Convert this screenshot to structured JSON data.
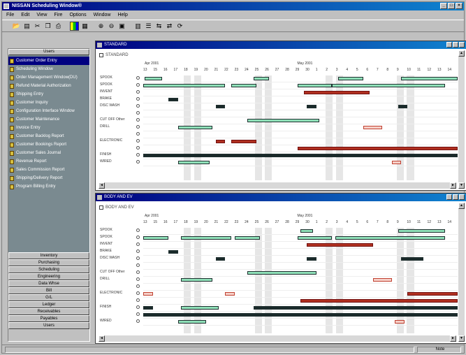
{
  "window": {
    "title": "NISSAN Scheduling Window®"
  },
  "menu": [
    "File",
    "Edit",
    "View",
    "Fire",
    "Options",
    "Window",
    "Help"
  ],
  "toolbar": [
    "open-icon",
    "save-icon",
    "cut-icon",
    "copy-icon",
    "print-icon",
    "color-icon",
    "tool-icon",
    "zoom-in-icon",
    "zoom-out-icon",
    "print-preview-icon",
    "grid-icon",
    "list-icon",
    "arrows-icon",
    "arrows-icon",
    "refresh-icon"
  ],
  "left_panel": {
    "header": "Users",
    "items": [
      "Customer Order Entry",
      "Scheduling Window",
      "Order Management Window(DU)",
      "Refund Material Authorization",
      "Shipping Entry",
      "Customer Inquiry",
      "Configuration Interface Window",
      "Customer Maintenance",
      "Invoice Entry",
      "Customer Backlog Report",
      "Customer Bookings Report",
      "Customer Sales Journal",
      "Revenue Report",
      "Sales Commission Report",
      "Shipping/Delivery Report",
      "Program Billing Entry"
    ],
    "buttons": [
      "Inventory",
      "Purchasing",
      "Scheduling",
      "Engineering",
      "Data Whse",
      "Bill",
      "G/L",
      "Ledger",
      "Receivables",
      "Payables",
      "Users"
    ]
  },
  "windows": [
    {
      "title": "STANDARD",
      "checkbox_label": "STANDARD",
      "months": [
        "Apr 2001",
        "May 2001"
      ],
      "days": [
        "13",
        "15",
        "16",
        "17",
        "18",
        "19",
        "20",
        "21",
        "22",
        "23",
        "24",
        "25",
        "26",
        "27",
        "28",
        "29",
        "30",
        "1",
        "2",
        "3",
        "4",
        "5",
        "6",
        "7",
        "8",
        "9",
        "10",
        "11",
        "12",
        "13",
        "14"
      ],
      "rows": [
        "SPOOK",
        "SPOOK",
        "INVENT",
        "BRAKE",
        "DISC WASH",
        "",
        "CUT OFF Other",
        "DRILL",
        "",
        "ELECTRONIC",
        "",
        "FINISH",
        "WIRED"
      ],
      "bars": [
        {
          "row": 0,
          "start": 0.5,
          "end": 6,
          "type": "g"
        },
        {
          "row": 0,
          "start": 35,
          "end": 40,
          "type": "g"
        },
        {
          "row": 0,
          "start": 62,
          "end": 70,
          "type": "g"
        },
        {
          "row": 0,
          "start": 82,
          "end": 100,
          "type": "g"
        },
        {
          "row": 1,
          "start": 0,
          "end": 26,
          "type": "g"
        },
        {
          "row": 1,
          "start": 28,
          "end": 36,
          "type": "g"
        },
        {
          "row": 1,
          "start": 49,
          "end": 60,
          "type": "g"
        },
        {
          "row": 1,
          "start": 60,
          "end": 96,
          "type": "g"
        },
        {
          "row": 2,
          "start": 51,
          "end": 72,
          "type": "r"
        },
        {
          "row": 3,
          "start": 8,
          "end": 11,
          "type": "d"
        },
        {
          "row": 4,
          "start": 23,
          "end": 26,
          "type": "d"
        },
        {
          "row": 4,
          "start": 52,
          "end": 55,
          "type": "d"
        },
        {
          "row": 4,
          "start": 81,
          "end": 84,
          "type": "d"
        },
        {
          "row": 6,
          "start": 33,
          "end": 56,
          "type": "g"
        },
        {
          "row": 7,
          "start": 11,
          "end": 22,
          "type": "g"
        },
        {
          "row": 7,
          "start": 70,
          "end": 76,
          "type": "w"
        },
        {
          "row": 9,
          "start": 23,
          "end": 26,
          "type": "r"
        },
        {
          "row": 9,
          "start": 28,
          "end": 36,
          "type": "r"
        },
        {
          "row": 10,
          "start": 49,
          "end": 100,
          "type": "r"
        },
        {
          "row": 11,
          "start": 0,
          "end": 100,
          "type": "d"
        },
        {
          "row": 12,
          "start": 11,
          "end": 21,
          "type": "g"
        },
        {
          "row": 12,
          "start": 79,
          "end": 82,
          "type": "w"
        }
      ]
    },
    {
      "title": "BODY AND EV",
      "checkbox_label": "BODY AND EV",
      "months": [
        "Apr 2001",
        "May 2001"
      ],
      "days": [
        "13",
        "15",
        "16",
        "17",
        "18",
        "19",
        "20",
        "21",
        "22",
        "23",
        "24",
        "25",
        "26",
        "27",
        "28",
        "29",
        "30",
        "1",
        "2",
        "3",
        "4",
        "5",
        "6",
        "7",
        "8",
        "9",
        "10",
        "11",
        "12",
        "13",
        "14"
      ],
      "rows": [
        "SPOOK",
        "SPOOK",
        "INVENT",
        "BRAKE",
        "DISC WASH",
        "",
        "CUT OFF Other",
        "DRILL",
        "",
        "ELECTRONIC",
        "",
        "FINISH",
        "",
        "WIRED"
      ],
      "bars": [
        {
          "row": 0,
          "start": 50,
          "end": 54,
          "type": "g"
        },
        {
          "row": 0,
          "start": 81,
          "end": 96,
          "type": "g"
        },
        {
          "row": 1,
          "start": 0,
          "end": 8,
          "type": "g"
        },
        {
          "row": 1,
          "start": 12,
          "end": 28,
          "type": "g"
        },
        {
          "row": 1,
          "start": 29,
          "end": 37,
          "type": "g"
        },
        {
          "row": 1,
          "start": 49,
          "end": 60,
          "type": "g"
        },
        {
          "row": 1,
          "start": 61,
          "end": 96,
          "type": "g"
        },
        {
          "row": 2,
          "start": 52,
          "end": 73,
          "type": "r"
        },
        {
          "row": 3,
          "start": 8,
          "end": 11,
          "type": "d"
        },
        {
          "row": 4,
          "start": 23,
          "end": 26,
          "type": "d"
        },
        {
          "row": 4,
          "start": 52,
          "end": 55,
          "type": "d"
        },
        {
          "row": 4,
          "start": 82,
          "end": 89,
          "type": "d"
        },
        {
          "row": 6,
          "start": 33,
          "end": 55,
          "type": "g"
        },
        {
          "row": 7,
          "start": 12,
          "end": 22,
          "type": "g"
        },
        {
          "row": 7,
          "start": 73,
          "end": 79,
          "type": "w"
        },
        {
          "row": 9,
          "start": 0,
          "end": 3,
          "type": "w"
        },
        {
          "row": 9,
          "start": 26,
          "end": 29,
          "type": "w"
        },
        {
          "row": 9,
          "start": 84,
          "end": 100,
          "type": "r"
        },
        {
          "row": 10,
          "start": 50,
          "end": 100,
          "type": "r"
        },
        {
          "row": 11,
          "start": 0,
          "end": 3,
          "type": "d"
        },
        {
          "row": 11,
          "start": 12,
          "end": 24,
          "type": "g"
        },
        {
          "row": 11,
          "start": 35,
          "end": 100,
          "type": "d"
        },
        {
          "row": 12,
          "start": 0,
          "end": 100,
          "type": "d"
        },
        {
          "row": 13,
          "start": 11,
          "end": 20,
          "type": "g"
        },
        {
          "row": 13,
          "start": 80,
          "end": 83,
          "type": "w"
        }
      ]
    }
  ],
  "status": {
    "right": "Note"
  }
}
